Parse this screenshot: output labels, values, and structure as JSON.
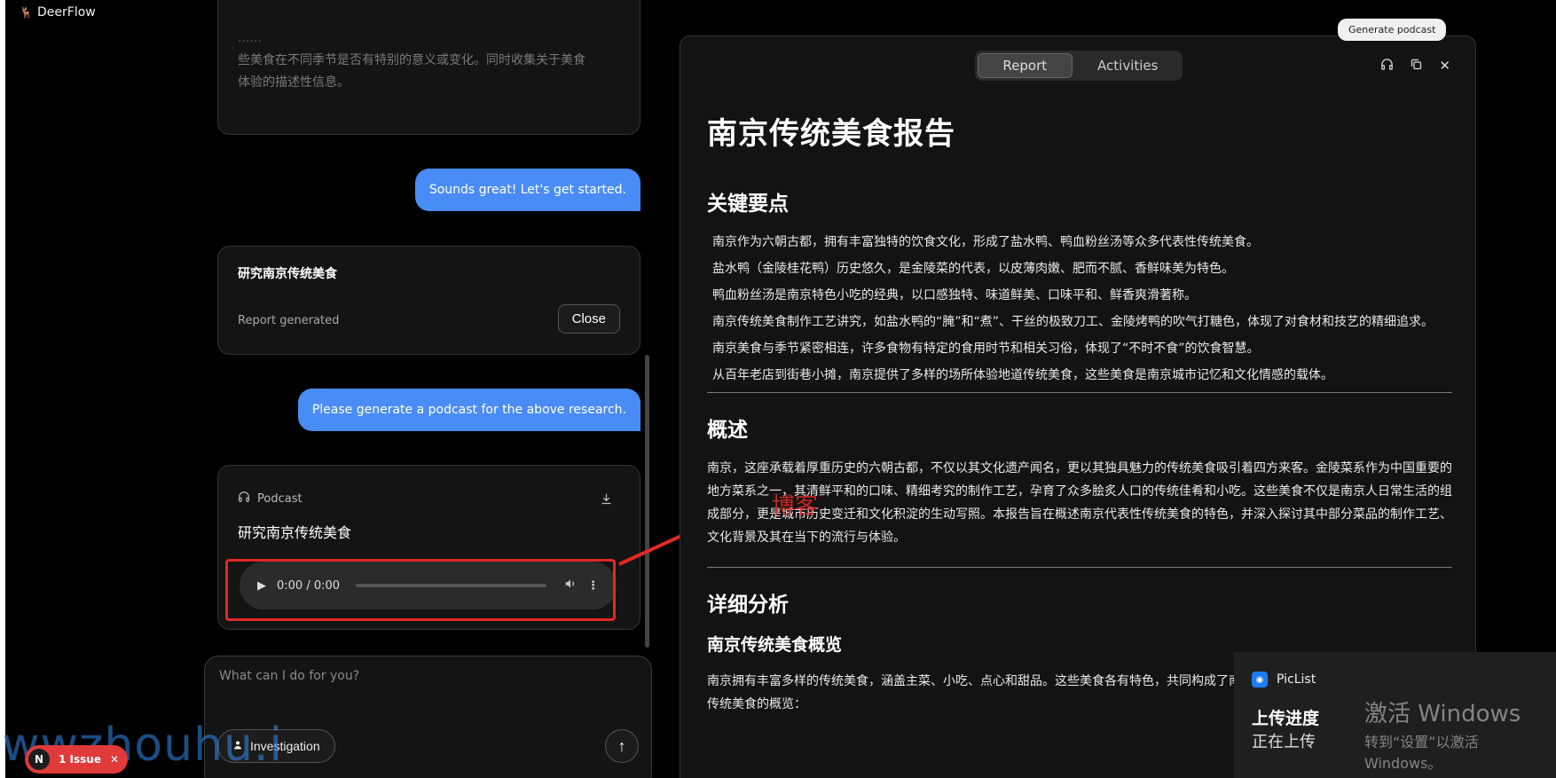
{
  "app": {
    "name": "DeerFlow"
  },
  "chat": {
    "plan_text_lines": [
      "......",
      "些美食在不同季节是否有特别的意义或变化。同时收集关于美食",
      "体验的描述性信息。"
    ],
    "user_message_1": "Sounds great! Let's get started.",
    "report_card": {
      "title": "研究南京传统美食",
      "status": "Report generated",
      "close_label": "Close"
    },
    "user_message_2": "Please generate a podcast for the above research.",
    "podcast_card": {
      "label": "Podcast",
      "title": "研究南京传统美食",
      "audio_time": "0:00 / 0:00"
    }
  },
  "input": {
    "placeholder": "What can I do for you?",
    "investigation_label": "Investigation"
  },
  "issue_badge": {
    "letter": "N",
    "label": "1 Issue"
  },
  "watermark_left": "wwzhouhu.i",
  "panel": {
    "tabs": [
      {
        "label": "Report",
        "active": true
      },
      {
        "label": "Activities",
        "active": false
      }
    ],
    "tooltip": "Generate podcast"
  },
  "report": {
    "title": "南京传统美食报告",
    "key_points_heading": "关键要点",
    "key_points": [
      "南京作为六朝古都，拥有丰富独特的饮食文化，形成了盐水鸭、鸭血粉丝汤等众多代表性传统美食。",
      "盐水鸭（金陵桂花鸭）历史悠久，是金陵菜的代表，以皮薄肉嫩、肥而不腻、香鲜味美为特色。",
      "鸭血粉丝汤是南京特色小吃的经典，以口感独特、味道鲜美、口味平和、鲜香爽滑著称。",
      "南京传统美食制作工艺讲究，如盐水鸭的“腌”和“煮”、干丝的极致刀工、金陵烤鸭的吹气打糖色，体现了对食材和技艺的精细追求。",
      "南京美食与季节紧密相连，许多食物有特定的食用时节和相关习俗，体现了“不时不食”的饮食智慧。",
      "从百年老店到街巷小摊，南京提供了多样的场所体验地道传统美食，这些美食是南京城市记忆和文化情感的载体。"
    ],
    "overview_heading": "概述",
    "overview_text": "南京，这座承载着厚重历史的六朝古都，不仅以其文化遗产闻名，更以其独具魅力的传统美食吸引着四方来客。金陵菜系作为中国重要的地方菜系之一，其清鲜平和的口味、精细考究的制作工艺，孕育了众多脍炙人口的传统佳肴和小吃。这些美食不仅是南京人日常生活的组成部分，更是城市历史变迁和文化积淀的生动写照。本报告旨在概述南京代表性传统美食的特色，并深入探讨其中部分菜品的制作工艺、文化背景及其在当下的流行与体验。",
    "detail_heading": "详细分析",
    "subheading": "南京传统美食概览",
    "subtext": "南京拥有丰富多样的传统美食，涵盖主菜、小吃、点心和甜品。这些美食各有特色，共同构成了南京独特的饮食文化。以下是部分代表性传统美食的概览："
  },
  "annotation": {
    "text": "博客",
    "color": "#e22828"
  },
  "notification": {
    "app": "PicList",
    "title": "上传进度",
    "subtitle": "正在上传"
  },
  "activate_windows": {
    "line1": "激活 Windows",
    "line2": "转到“设置”以激活 Windows。"
  }
}
